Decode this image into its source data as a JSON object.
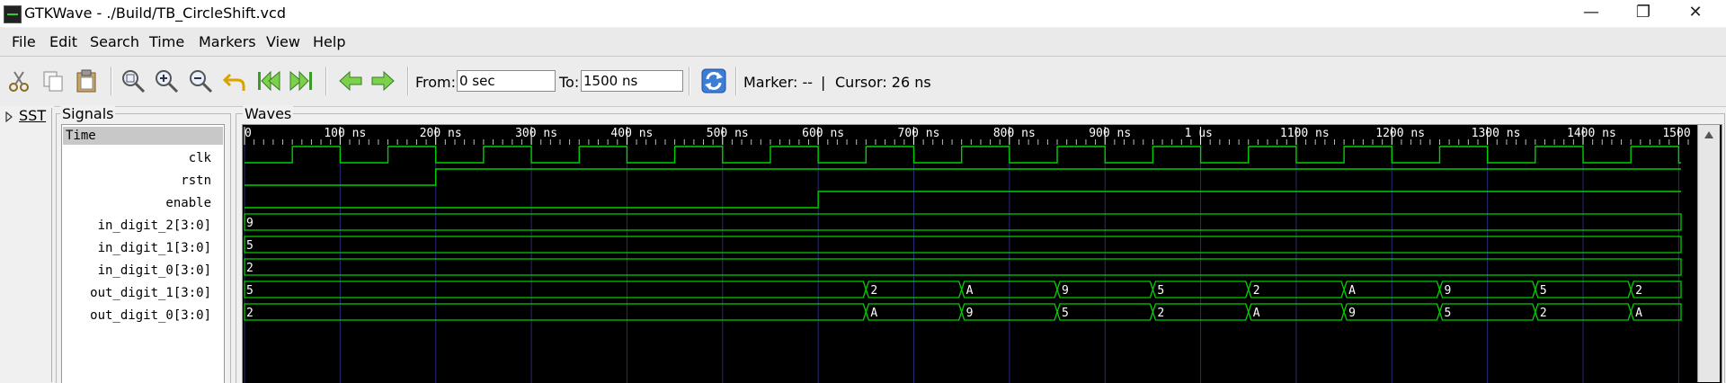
{
  "window": {
    "title": "GTKWave - ./Build/TB_CircleShift.vcd"
  },
  "menu": [
    "File",
    "Edit",
    "Search",
    "Time",
    "Markers",
    "View",
    "Help"
  ],
  "toolbar": {
    "icons": [
      "cut-icon",
      "copy-icon",
      "paste-icon",
      "zoom-fit-icon",
      "zoom-in-icon",
      "zoom-out-icon",
      "undo-zoom-icon",
      "jump-start-icon",
      "jump-end-icon",
      "prev-edge-icon",
      "next-edge-icon",
      "reload-icon"
    ],
    "from_label": "From:",
    "from_value": "0 sec",
    "to_label": "To:",
    "to_value": "1500 ns",
    "marker_text": "Marker: --",
    "separator": "|",
    "cursor_text": "Cursor: 26 ns"
  },
  "sst": {
    "label": "SST"
  },
  "signals": {
    "title": "Signals",
    "header": "Time",
    "names": [
      "clk",
      "rstn",
      "enable",
      "in_digit_2[3:0]",
      "in_digit_1[3:0]",
      "in_digit_0[3:0]",
      "out_digit_1[3:0]",
      "out_digit_0[3:0]"
    ]
  },
  "waves": {
    "title": "Waves",
    "time_start": 0,
    "time_end": 1510,
    "ticks": [
      {
        "t": 0,
        "label": "0"
      },
      {
        "t": 100,
        "label": "100 ns"
      },
      {
        "t": 200,
        "label": "200 ns"
      },
      {
        "t": 300,
        "label": "300 ns"
      },
      {
        "t": 400,
        "label": "400 ns"
      },
      {
        "t": 500,
        "label": "500 ns"
      },
      {
        "t": 600,
        "label": "600 ns"
      },
      {
        "t": 700,
        "label": "700 ns"
      },
      {
        "t": 800,
        "label": "800 ns"
      },
      {
        "t": 900,
        "label": "900 ns"
      },
      {
        "t": 1000,
        "label": "1 us"
      },
      {
        "t": 1100,
        "label": "1100 ns"
      },
      {
        "t": 1200,
        "label": "1200 ns"
      },
      {
        "t": 1300,
        "label": "1300 ns"
      },
      {
        "t": 1400,
        "label": "1400 ns"
      },
      {
        "t": 1500,
        "label": "1500"
      }
    ],
    "clk": {
      "period": 100,
      "first_rise": 50
    },
    "rstn": {
      "initial": 0,
      "rise_at": 200
    },
    "enable": {
      "initial": 0,
      "rise_at": 600
    },
    "buses": [
      {
        "name": "in_digit_2",
        "segments": [
          {
            "t": 0,
            "v": "9"
          }
        ]
      },
      {
        "name": "in_digit_1",
        "segments": [
          {
            "t": 0,
            "v": "5"
          }
        ]
      },
      {
        "name": "in_digit_0",
        "segments": [
          {
            "t": 0,
            "v": "2"
          }
        ]
      },
      {
        "name": "out_digit_1",
        "segments": [
          {
            "t": 0,
            "v": "5"
          },
          {
            "t": 650,
            "v": "2"
          },
          {
            "t": 750,
            "v": "A"
          },
          {
            "t": 850,
            "v": "9"
          },
          {
            "t": 950,
            "v": "5"
          },
          {
            "t": 1050,
            "v": "2"
          },
          {
            "t": 1150,
            "v": "A"
          },
          {
            "t": 1250,
            "v": "9"
          },
          {
            "t": 1350,
            "v": "5"
          },
          {
            "t": 1450,
            "v": "2"
          }
        ]
      },
      {
        "name": "out_digit_0",
        "segments": [
          {
            "t": 0,
            "v": "2"
          },
          {
            "t": 650,
            "v": "A"
          },
          {
            "t": 750,
            "v": "9"
          },
          {
            "t": 850,
            "v": "5"
          },
          {
            "t": 950,
            "v": "2"
          },
          {
            "t": 1050,
            "v": "A"
          },
          {
            "t": 1150,
            "v": "9"
          },
          {
            "t": 1250,
            "v": "5"
          },
          {
            "t": 1350,
            "v": "2"
          },
          {
            "t": 1450,
            "v": "A"
          }
        ]
      }
    ],
    "colors": {
      "background": "#000000",
      "trace": "#00d000",
      "grid": "#2a2a78",
      "ruler_text": "#ffffff",
      "value_text": "#ffffff"
    }
  }
}
